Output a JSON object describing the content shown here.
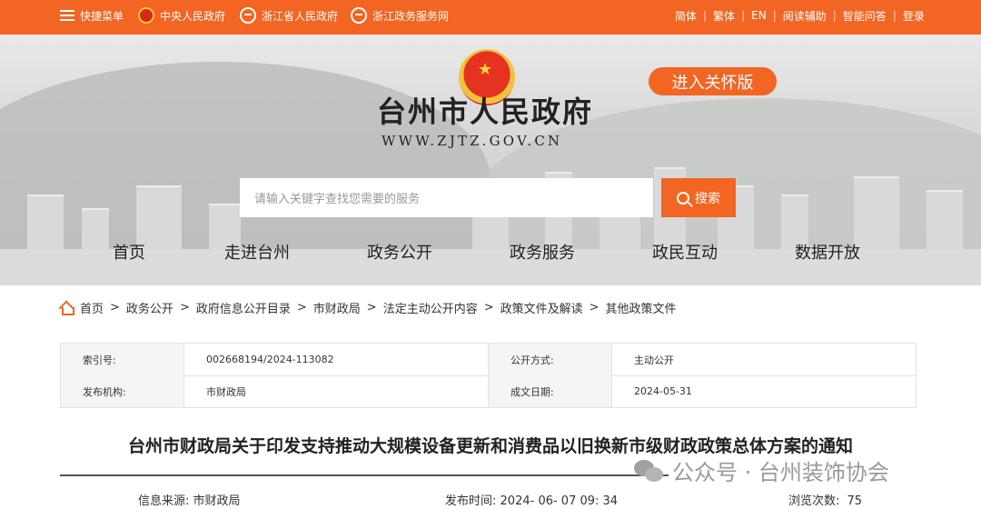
{
  "topbar": {
    "quick_menu": "快捷菜单",
    "central_gov": "中央人民政府",
    "zhejiang_gov": "浙江省人民政府",
    "zhejiang_service": "浙江政务服务网",
    "links": [
      "简体",
      "繁体",
      "EN",
      "阅读辅助",
      "智能问答",
      "登录"
    ]
  },
  "header": {
    "title": "台州市人民政府",
    "url": "WWW.ZJTZ.GOV.CN",
    "care_button": "进入关怀版",
    "search_placeholder": "请输入关键字查找您需要的服务",
    "search_button": "搜索"
  },
  "nav": [
    "首页",
    "走进台州",
    "政务公开",
    "政务服务",
    "政民互动",
    "数据开放"
  ],
  "breadcrumb": [
    "首页",
    "政务公开",
    "政府信息公开目录",
    "市财政局",
    "法定主动公开内容",
    "政策文件及解读",
    "其他政策文件"
  ],
  "info": {
    "index_label": "索引号:",
    "index_value": "002668194/2024-113082",
    "open_label": "公开方式:",
    "open_value": "主动公开",
    "org_label": "发布机构:",
    "org_value": "市财政局",
    "date_label": "成文日期:",
    "date_value": "2024-05-31"
  },
  "document": {
    "title": "台州市财政局关于印发支持推动大规模设备更新和消费品以旧换新市级财政政策总体方案的通知",
    "source_label": "信息来源:",
    "source_value": "市财政局",
    "publish_label": "发布时间:",
    "publish_value": "2024- 06- 07 09: 34",
    "views_label": "浏览次数:",
    "views_value": "75"
  },
  "watermark": "公众号 · 台州装饰协会",
  "colors": {
    "accent": "#f26522"
  }
}
